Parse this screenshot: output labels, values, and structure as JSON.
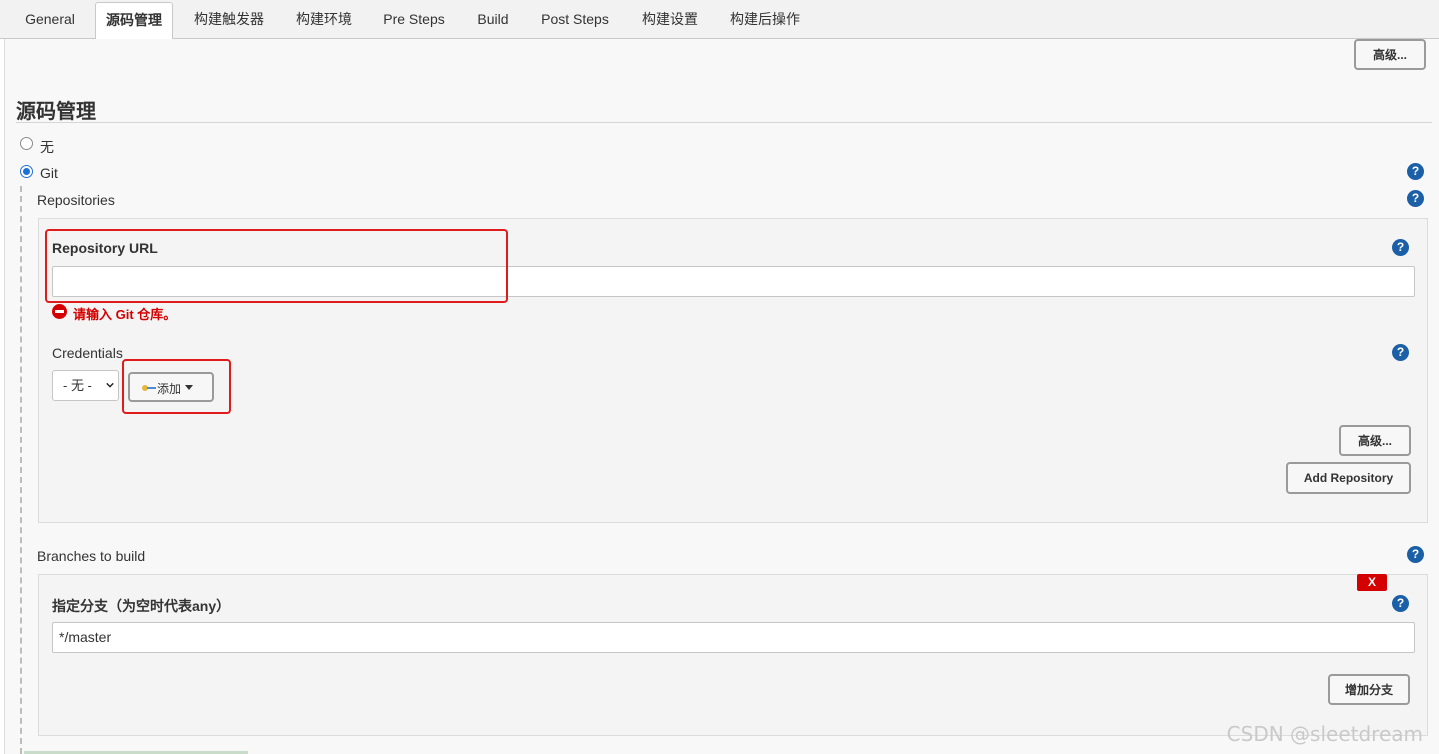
{
  "tabs": [
    {
      "label": "General",
      "active": false
    },
    {
      "label": "源码管理",
      "active": true
    },
    {
      "label": "构建触发器",
      "active": false
    },
    {
      "label": "构建环境",
      "active": false
    },
    {
      "label": "Pre Steps",
      "active": false
    },
    {
      "label": "Build",
      "active": false
    },
    {
      "label": "Post Steps",
      "active": false
    },
    {
      "label": "构建设置",
      "active": false
    },
    {
      "label": "构建后操作",
      "active": false
    }
  ],
  "top_advanced_label": "高级...",
  "section": {
    "title": "源码管理"
  },
  "scm": {
    "option_none": "无",
    "option_git": "Git",
    "selected": "Git"
  },
  "repositories": {
    "heading": "Repositories",
    "url_label": "Repository URL",
    "url_value": "",
    "error": "请输入 Git 仓库。",
    "credentials_label": "Credentials",
    "credentials_selected": "- 无 -",
    "add_label": "添加",
    "advanced_label": "高级...",
    "add_repository_label": "Add Repository"
  },
  "branches": {
    "heading": "Branches to build",
    "delete_label": "X",
    "specifier_label": "指定分支（为空时代表any）",
    "specifier_value": "*/master",
    "add_branch_label": "增加分支"
  },
  "help_icon_glyph": "?",
  "watermark": "CSDN @sleetdream",
  "colors": {
    "accent": "#1b5fa7",
    "error": "#d40000",
    "highlight": "#e11b1b"
  }
}
